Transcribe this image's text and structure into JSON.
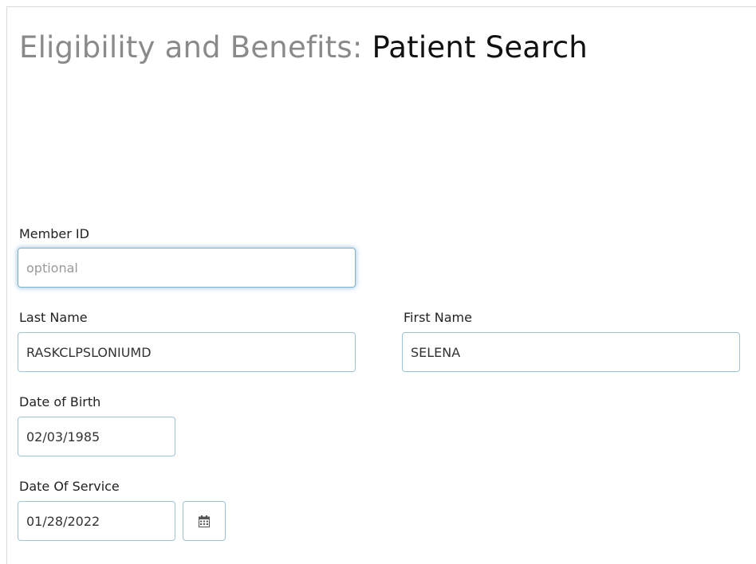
{
  "page": {
    "title_prefix": "Eligibility and Benefits:",
    "title_main": "Patient Search"
  },
  "form": {
    "member_id": {
      "label": "Member ID",
      "value": "",
      "placeholder": "optional"
    },
    "last_name": {
      "label": "Last Name",
      "value": "RASKCLPSLONIUMD"
    },
    "first_name": {
      "label": "First Name",
      "value": "SELENA"
    },
    "date_of_birth": {
      "label": "Date of Birth",
      "value": "02/03/1985"
    },
    "date_of_service": {
      "label": "Date Of Service",
      "value": "01/28/2022",
      "icon": "calendar-icon"
    }
  },
  "colors": {
    "field_border": "#9cc3d6",
    "focus_glow": "#66a0c8",
    "title_prefix": "#8a8a8a",
    "title_main": "#111111"
  }
}
